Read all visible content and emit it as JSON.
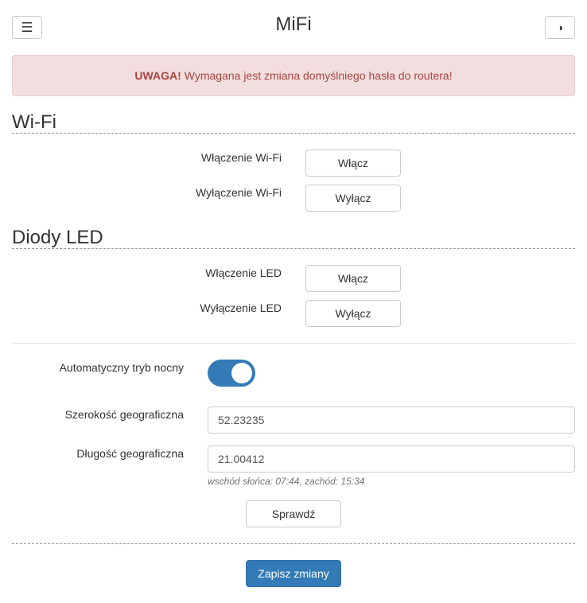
{
  "header": {
    "title": "MiFi",
    "menu_icon": "☰",
    "theme_icon": "◑"
  },
  "alert": {
    "strong": "UWAGA!",
    "text": "Wymagana jest zmiana domyślniego hasła do routera!"
  },
  "wifi": {
    "title": "Wi-Fi",
    "enable_label": "Włączenie Wi-Fi",
    "enable_button": "Włącz",
    "disable_label": "Wyłączenie Wi-Fi",
    "disable_button": "Wyłącz"
  },
  "led": {
    "title": "Diody LED",
    "enable_label": "Włączenie LED",
    "enable_button": "Włącz",
    "disable_label": "Wyłączenie LED",
    "disable_button": "Wyłącz"
  },
  "night": {
    "auto_label": "Automatyczny tryb nocny",
    "auto_enabled": true,
    "latitude_label": "Szerokość geograficzna",
    "latitude_value": "52.23235",
    "longitude_label": "Długość geograficzna",
    "longitude_value": "21.00412",
    "sun_info": "wschód słońca: 07:44, zachód: 15:34",
    "check_button": "Sprawdź"
  },
  "footer": {
    "save_button": "Zapisz zmiany"
  },
  "colors": {
    "primary": "#337ab7",
    "alert_bg": "#f2dede",
    "alert_text": "#a94442"
  }
}
